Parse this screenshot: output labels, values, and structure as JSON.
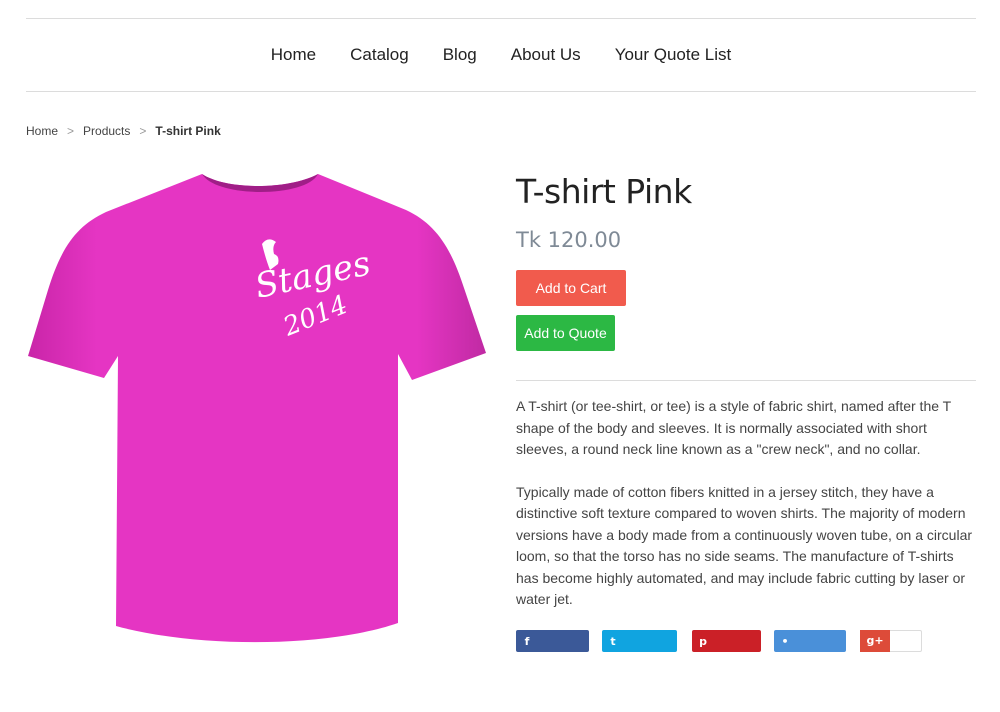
{
  "nav": {
    "items": [
      {
        "label": "Home"
      },
      {
        "label": "Catalog"
      },
      {
        "label": "Blog"
      },
      {
        "label": "About Us"
      },
      {
        "label": "Your Quote List"
      }
    ]
  },
  "breadcrumb": {
    "home": "Home",
    "products": "Products",
    "current": "T-shirt Pink",
    "separator": ">"
  },
  "product": {
    "title": "T-shirt Pink",
    "price": "Tk 120.00",
    "image_print_text": "Stages 2014",
    "shirt_color": "#e535c3",
    "add_to_cart_label": "Add to Cart",
    "add_to_quote_label": "Add to Quote",
    "description": [
      "A T-shirt (or tee-shirt, or tee) is a style of fabric shirt, named after the T shape of the body and sleeves. It is normally associated with short sleeves, a round neck line known as a \"crew neck\", and no collar.",
      "Typically made of cotton fibers knitted in a jersey stitch, they have a distinctive soft texture compared to woven shirts. The majority of modern versions have a body made from a continuously woven tube, on a circular loom, so that the torso has no side seams. The manufacture of T-shirts has become highly automated, and may include fabric cutting by laser or water jet."
    ]
  },
  "share": {
    "buttons": [
      {
        "icon": "facebook-icon",
        "glyph": "f",
        "color": "#3b5998"
      },
      {
        "icon": "twitter-icon",
        "glyph": "t",
        "color": "#10a4e0"
      },
      {
        "icon": "pinterest-icon",
        "glyph": "p",
        "color": "#cb2027"
      },
      {
        "icon": "tumblr-icon",
        "glyph": "•",
        "color": "#4a90d9"
      },
      {
        "icon": "google-plus-icon",
        "glyph": "g+",
        "color": "#dd4b39"
      }
    ]
  },
  "colors": {
    "cart_button": "#f15b4d",
    "quote_button": "#2cb844",
    "price_text": "#7f8a96"
  }
}
